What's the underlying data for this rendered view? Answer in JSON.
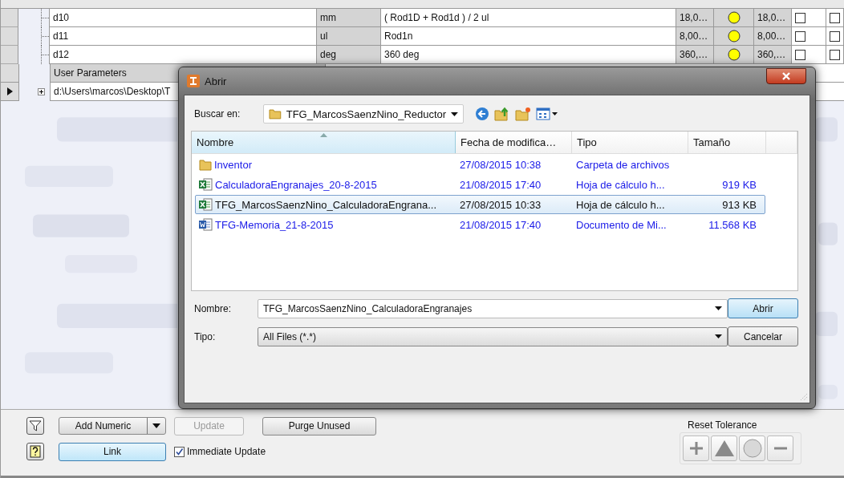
{
  "parameters": [
    {
      "name": "d10",
      "unit": "mm",
      "equation": "( Rod1D + Rod1d ) / 2 ul",
      "nominal": "18,0…",
      "model_value": "18,0…",
      "check_1": false,
      "check_2": false
    },
    {
      "name": "d11",
      "unit": "ul",
      "equation": "Rod1n",
      "nominal": "8,00…",
      "model_value": "8,00…",
      "check_1": false,
      "check_2": false
    },
    {
      "name": "d12",
      "unit": "deg",
      "equation": "360 deg",
      "nominal": "360,…",
      "model_value": "360,…",
      "check_1": false,
      "check_2": false
    }
  ],
  "group_rows": [
    {
      "label": "User Parameters",
      "kind": "group"
    },
    {
      "label": "d:\\Users\\marcos\\Desktop\\T",
      "kind": "linked"
    }
  ],
  "dialog": {
    "title": "Abrir",
    "look_in_label": "Buscar en:",
    "look_in": "TFG_MarcosSaenzNino_Reductor",
    "columns": [
      "Nombre",
      "Fecha de modifica…",
      "Tipo",
      "Tamaño"
    ],
    "files": [
      {
        "name": "Inventor",
        "date": "27/08/2015 10:38",
        "type": "Carpeta de archivos",
        "kind": "folder",
        "selected": false
      },
      {
        "name": "CalculadoraEngranajes_20-8-2015",
        "date": "21/08/2015 17:40",
        "type": "Hoja de cálculo h...",
        "size": "919 KB",
        "kind": "spreadsheet",
        "selected": false
      },
      {
        "name": "TFG_MarcosSaenzNino_CalculadoraEngrana...",
        "date": "27/08/2015 10:33",
        "type": "Hoja de cálculo h...",
        "size": "913 KB",
        "kind": "spreadsheet",
        "selected": true
      },
      {
        "name": "TFG-Memoria_21-8-2015",
        "date": "21/08/2015 17:40",
        "type": "Documento de Mi...",
        "size": "11.568 KB",
        "kind": "document",
        "selected": false
      }
    ],
    "file_name_label": "Nombre:",
    "file_name": "TFG_MarcosSaenzNino_CalculadoraEngranajes",
    "file_type_label": "Tipo:",
    "file_type": "All Files (*.*)",
    "open_button": "Abrir",
    "cancel_button": "Cancelar"
  },
  "toolbar": {
    "add_numeric": "Add Numeric",
    "update": {
      "label": "Update",
      "disabled": true
    },
    "purge": "Purge Unused",
    "link": "Link",
    "immediate_update": {
      "label": "Immediate Update",
      "checked": true
    },
    "reset_tolerance": "Reset Tolerance"
  }
}
